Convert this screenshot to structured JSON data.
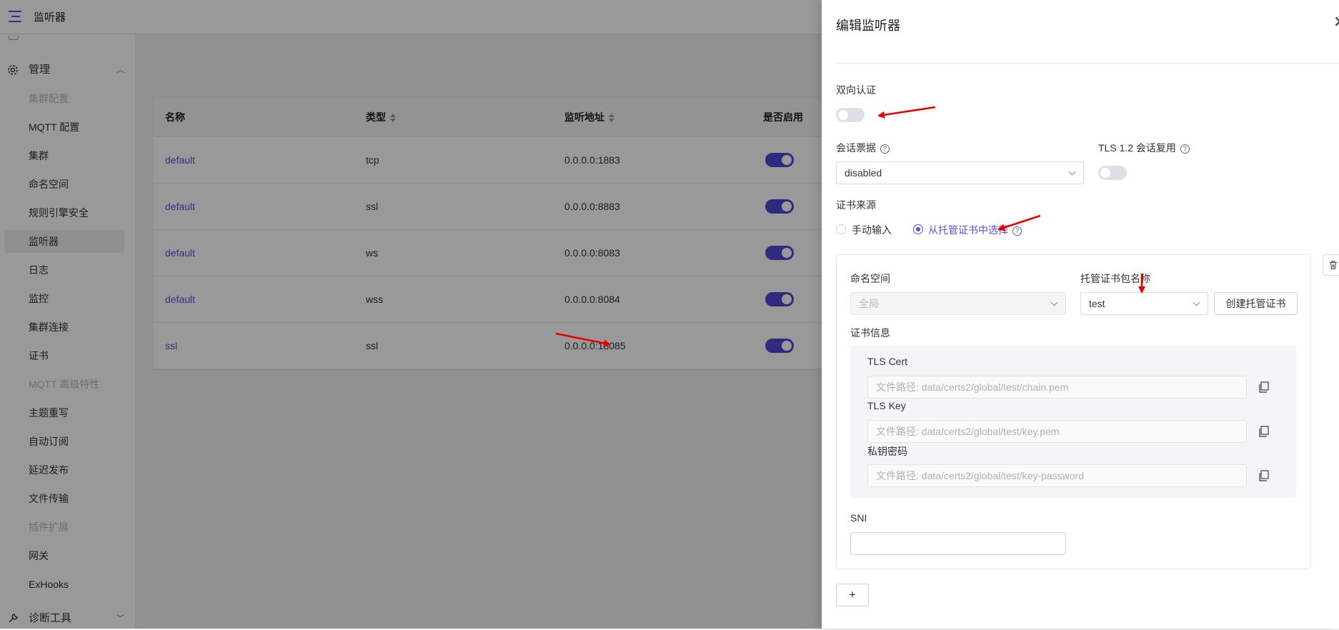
{
  "topbar": {
    "title": "监听器"
  },
  "sidebar": {
    "group_admin": "管理",
    "group_diag": "诊断工具",
    "items": [
      {
        "label": "集群配置",
        "state": "disabled"
      },
      {
        "label": "MQTT 配置",
        "state": "normal"
      },
      {
        "label": "集群",
        "state": "normal"
      },
      {
        "label": "命名空间",
        "state": "normal"
      },
      {
        "label": "规则引擎安全",
        "state": "normal"
      },
      {
        "label": "监听器",
        "state": "active"
      },
      {
        "label": "日志",
        "state": "normal"
      },
      {
        "label": "监控",
        "state": "normal"
      },
      {
        "label": "集群连接",
        "state": "normal"
      },
      {
        "label": "证书",
        "state": "normal"
      },
      {
        "label": "MQTT 高级特性",
        "state": "disabled"
      },
      {
        "label": "主题重写",
        "state": "normal"
      },
      {
        "label": "自动订阅",
        "state": "normal"
      },
      {
        "label": "延迟发布",
        "state": "normal"
      },
      {
        "label": "文件传输",
        "state": "normal"
      },
      {
        "label": "插件扩展",
        "state": "disabled"
      },
      {
        "label": "网关",
        "state": "normal"
      },
      {
        "label": "ExHooks",
        "state": "normal"
      }
    ]
  },
  "table": {
    "columns": [
      "名称",
      "类型",
      "监听地址",
      "是否启用"
    ],
    "rows": [
      {
        "name": "default",
        "type": "tcp",
        "address": "0.0.0.0:1883",
        "enabled": true
      },
      {
        "name": "default",
        "type": "ssl",
        "address": "0.0.0.0:8883",
        "enabled": true
      },
      {
        "name": "default",
        "type": "ws",
        "address": "0.0.0.0:8083",
        "enabled": true
      },
      {
        "name": "default",
        "type": "wss",
        "address": "0.0.0.0:8084",
        "enabled": true
      },
      {
        "name": "ssl",
        "type": "ssl",
        "address": "0.0.0.0:18085",
        "enabled": true
      }
    ]
  },
  "drawer": {
    "title": "编辑监听器",
    "mutual_auth": {
      "label": "双向认证",
      "on": false
    },
    "session_ticket": {
      "label": "会话票据",
      "value": "disabled"
    },
    "tls12_reuse": {
      "label": "TLS 1.2 会话复用",
      "on": false
    },
    "cert_source": {
      "label": "证书来源",
      "options": [
        "手动输入",
        "从托管证书中选择"
      ],
      "selected": "从托管证书中选择"
    },
    "namespace": {
      "label": "命名空间",
      "value": "全局"
    },
    "bundle": {
      "label": "托管证书包名称",
      "value": "test"
    },
    "create_button": "创建托管证书",
    "cert_info": {
      "label": "证书信息",
      "tls_cert": {
        "label": "TLS Cert",
        "placeholder": "文件路径: data/certs2/global/test/chain.pem"
      },
      "tls_key": {
        "label": "TLS Key",
        "placeholder": "文件路径: data/certs2/global/test/key.pem"
      },
      "key_password": {
        "label": "私钥密码",
        "placeholder": "文件路径: data/certs2/global/test/key-password"
      }
    },
    "sni": {
      "label": "SNI",
      "value": ""
    },
    "add_button": "+"
  },
  "colors": {
    "accent": "#5b4ee0",
    "switch_on": "#5046d2",
    "annotation": "#e60000"
  }
}
